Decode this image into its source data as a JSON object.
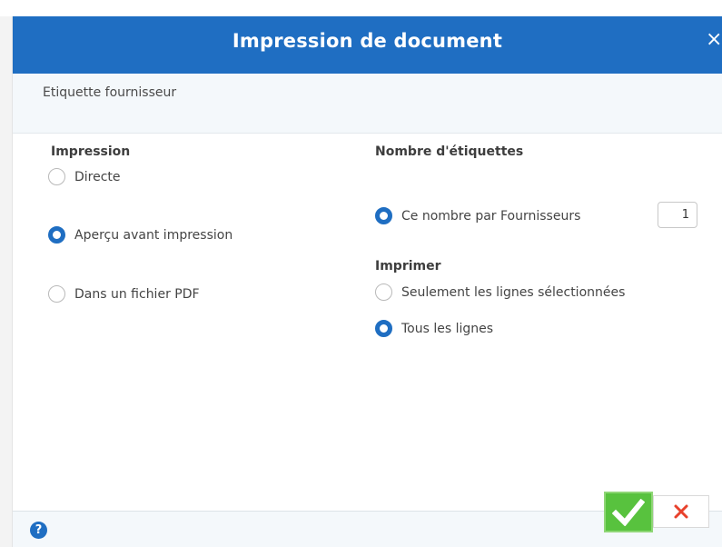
{
  "dialog": {
    "title": "Impression de document",
    "close_glyph": "×",
    "subtitle": "Etiquette fournisseur"
  },
  "impression": {
    "title": "Impression",
    "options": [
      {
        "label": "Directe",
        "checked": false
      },
      {
        "label": "Aperçu avant impression",
        "checked": true
      },
      {
        "label": "Dans un fichier PDF",
        "checked": false
      }
    ]
  },
  "nombre": {
    "title": "Nombre d'étiquettes",
    "option_label": "Ce nombre par Fournisseurs",
    "option_checked": true,
    "value": "1"
  },
  "imprimer": {
    "title": "Imprimer",
    "options": [
      {
        "label": "Seulement les lignes sélectionnées",
        "checked": false
      },
      {
        "label": "Tous les lignes",
        "checked": true
      }
    ]
  },
  "footer": {
    "help_glyph": "?",
    "ok_icon": "checkmark-icon",
    "cancel_icon": "close-icon"
  },
  "colors": {
    "accent": "#1f6ec2",
    "ok_green": "#58c23e",
    "cancel_red": "#e8412c"
  }
}
